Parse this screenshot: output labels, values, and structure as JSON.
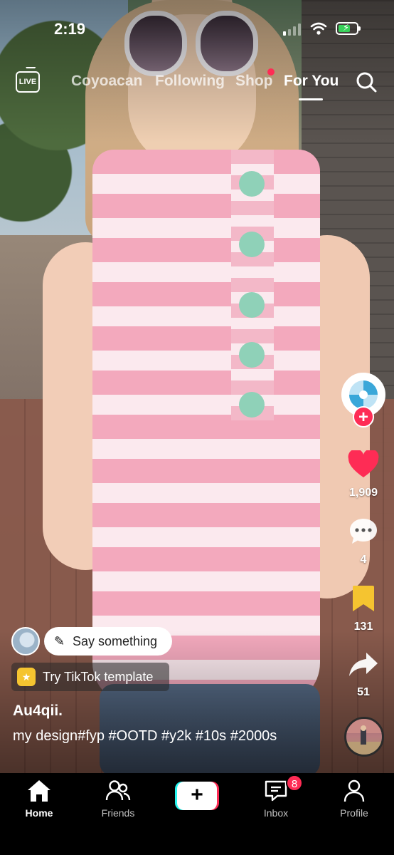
{
  "status_bar": {
    "time": "2:19"
  },
  "top_nav": {
    "live_label": "LIVE",
    "tabs": [
      {
        "label": "Coyoacan",
        "active": false
      },
      {
        "label": "Following",
        "active": false
      },
      {
        "label": "Shop",
        "active": false
      },
      {
        "label": "For You",
        "active": true
      }
    ]
  },
  "rail": {
    "likes": "1,909",
    "comments": "4",
    "saves": "131",
    "shares": "51"
  },
  "caption_area": {
    "say_something": "Say something",
    "template_label": "Try TikTok template",
    "username": "Au4qii.",
    "caption": "my design#fyp #OOTD #y2k #10s #2000s"
  },
  "bottom_nav": {
    "items": [
      {
        "label": "Home",
        "active": true
      },
      {
        "label": "Friends",
        "active": false
      },
      {
        "label": "Inbox",
        "active": false
      },
      {
        "label": "Profile",
        "active": false
      }
    ],
    "inbox_badge": "8"
  },
  "colors": {
    "accent": "#fe2c55",
    "cyan": "#25f4ee",
    "save_yellow": "#f5c430"
  }
}
